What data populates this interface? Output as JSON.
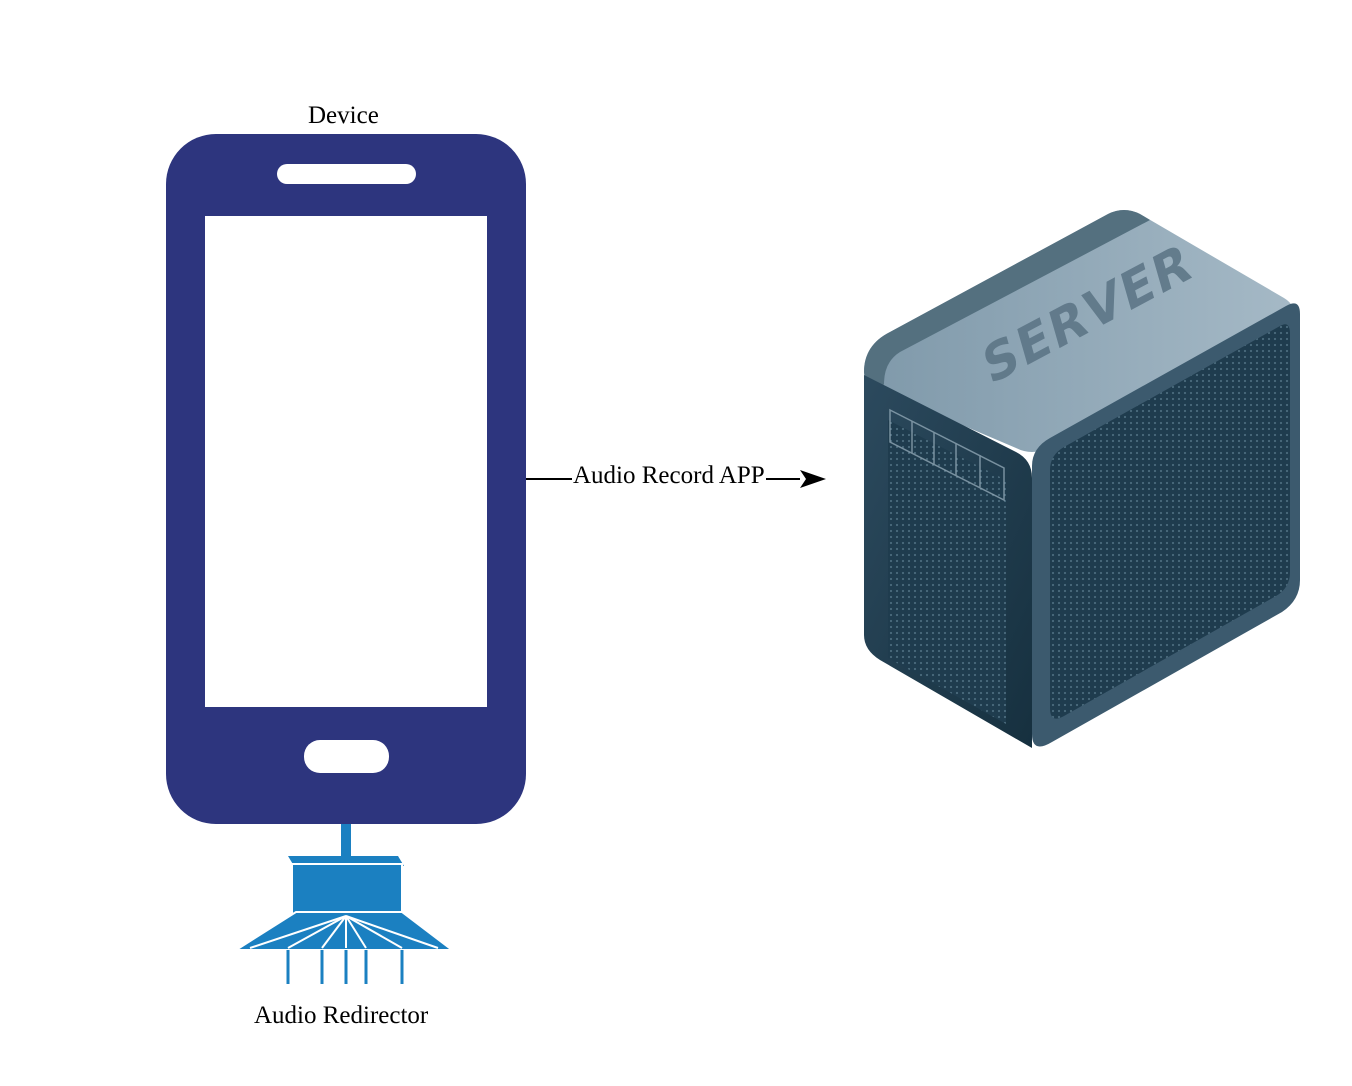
{
  "diagram": {
    "nodes": {
      "device": {
        "label": "Device",
        "icon": "smartphone-icon",
        "color": "#2d357e"
      },
      "audio_redirector": {
        "label": "Audio Redirector",
        "icon": "speaker-splitter-icon",
        "color": "#1b80c1"
      },
      "server": {
        "icon": "server-icon",
        "case_text": "SERVER",
        "case_color": "#3c5a6e"
      }
    },
    "edges": [
      {
        "from": "device",
        "to": "server",
        "label": "Audio Record APP",
        "arrow": "end"
      },
      {
        "from": "device",
        "to": "audio_redirector",
        "label": "",
        "arrow": "none"
      }
    ]
  }
}
